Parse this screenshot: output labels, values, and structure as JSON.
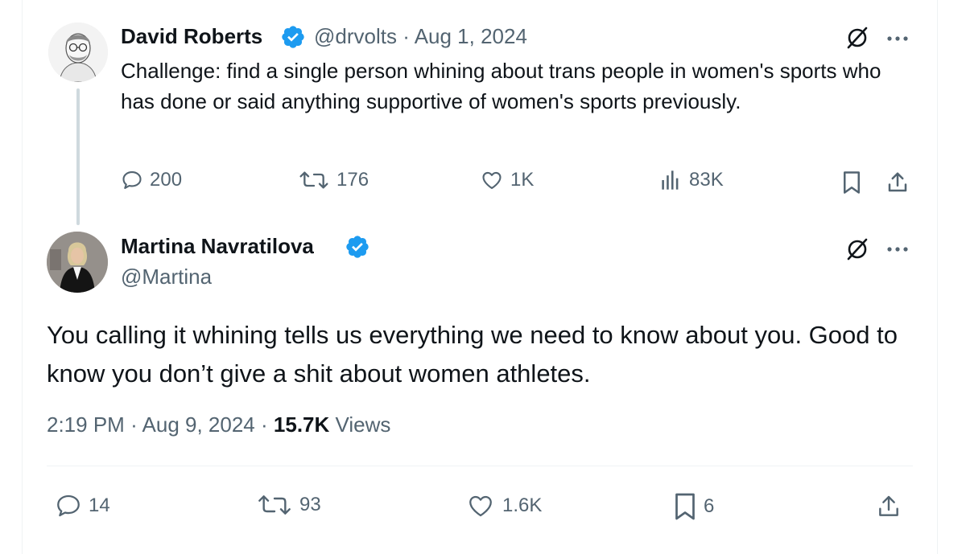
{
  "parent_tweet": {
    "author_name": "David Roberts",
    "handle": "@drvolts",
    "separator": "·",
    "date": "Aug 1, 2024",
    "text": "Challenge: find a single person whining about trans people in women's sports who has done or said anything supportive of women's sports previously.",
    "stats": {
      "replies": "200",
      "reposts": "176",
      "likes": "1K",
      "views": "83K"
    }
  },
  "reply_tweet": {
    "author_name": "Martina Navratilova",
    "handle": "@Martina",
    "text": "You calling it whining tells us everything we need to know about you. Good to know you don’t give a shit about women athletes.",
    "time": "2:19 PM",
    "sep1": "·",
    "date": "Aug 9, 2024",
    "sep2": "·",
    "views_count": "15.7K",
    "views_label": "Views",
    "stats": {
      "replies": "14",
      "reposts": "93",
      "likes": "1.6K",
      "bookmarks": "6"
    }
  },
  "colors": {
    "verified": "#1d9bf0",
    "muted": "#536471",
    "text": "#0f1419",
    "thread_line": "#cfd9de"
  },
  "icons": [
    "verified-badge-icon",
    "grok-icon",
    "more-icon",
    "reply-icon",
    "repost-icon",
    "like-icon",
    "views-icon",
    "bookmark-icon",
    "share-icon"
  ]
}
